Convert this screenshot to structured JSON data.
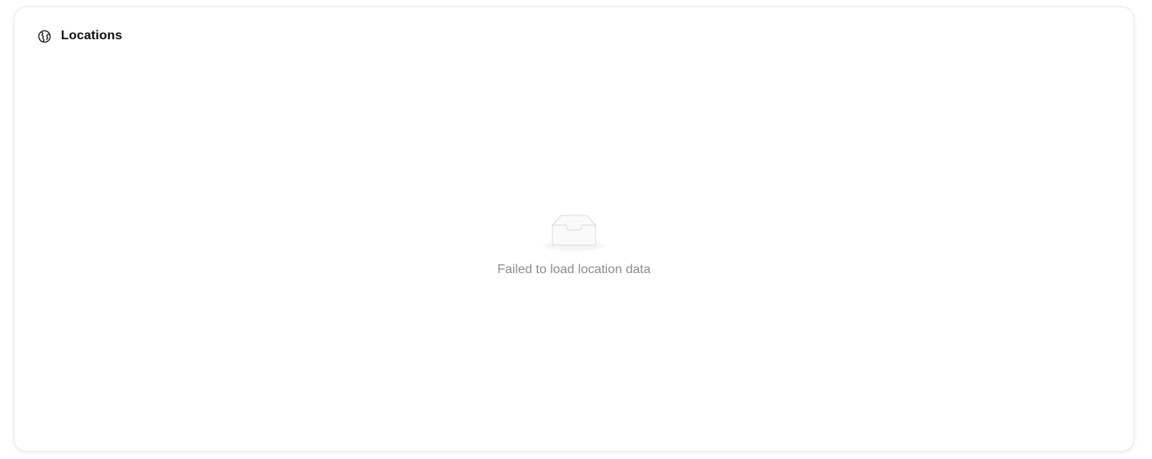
{
  "card": {
    "title": "Locations",
    "title_icon": "globe-icon"
  },
  "empty_state": {
    "icon": "empty-inbox-icon",
    "message": "Failed to load location data"
  }
}
